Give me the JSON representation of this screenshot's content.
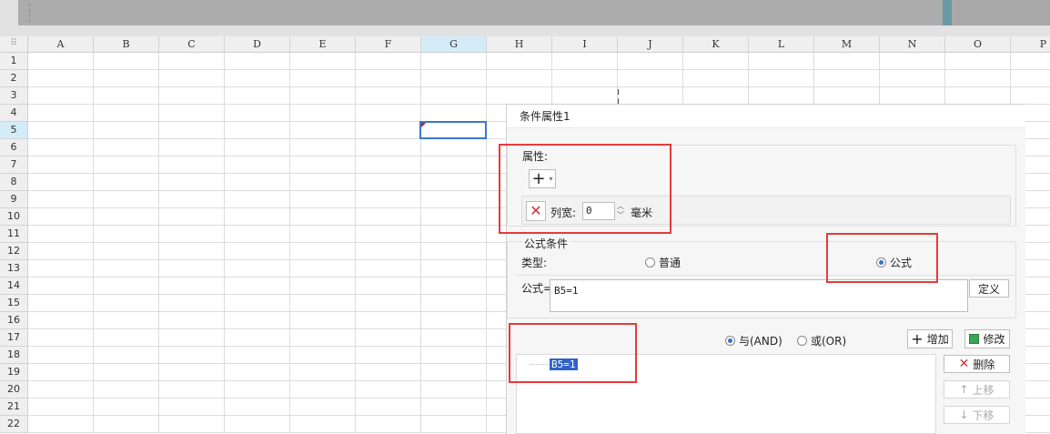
{
  "sheet": {
    "columns": [
      "A",
      "B",
      "C",
      "D",
      "E",
      "F",
      "G",
      "H",
      "I",
      "J",
      "K",
      "L",
      "M",
      "N",
      "O",
      "P"
    ],
    "rows": [
      "1",
      "2",
      "3",
      "4",
      "5",
      "6",
      "7",
      "8",
      "9",
      "10",
      "11",
      "12",
      "13",
      "14",
      "15",
      "16",
      "17",
      "18",
      "19",
      "20",
      "21",
      "22"
    ],
    "selected_column": "G",
    "selected_row": "5",
    "corner_glyph": "⠿"
  },
  "dialog": {
    "title": "条件属性1",
    "properties": {
      "label": "属性:",
      "add_glyph": "+",
      "dropdown_glyph": "▾",
      "item": {
        "delete_glyph": "✕",
        "name": "列宽:",
        "value": "0",
        "unit": "毫米"
      }
    },
    "formula_condition": {
      "title": "公式条件",
      "type_label": "类型:",
      "type_options": [
        {
          "label": "普通",
          "selected": false
        },
        {
          "label": "公式",
          "selected": true
        }
      ],
      "formula_label": "公式=",
      "formula_value": "B5=1",
      "define_button": "定义"
    },
    "logic": {
      "and_label": "与(AND)",
      "and_selected": true,
      "or_label": "或(OR)",
      "or_selected": false
    },
    "buttons": {
      "add": "增加",
      "modify": "修改",
      "delete": "删除",
      "move_up": "上移",
      "move_down": "下移"
    },
    "conditions": [
      "B5=1"
    ]
  },
  "colors": {
    "highlight_border": "#e53b3b",
    "selection_blue": "#3a78d0",
    "list_selection": "#2f62c9"
  }
}
